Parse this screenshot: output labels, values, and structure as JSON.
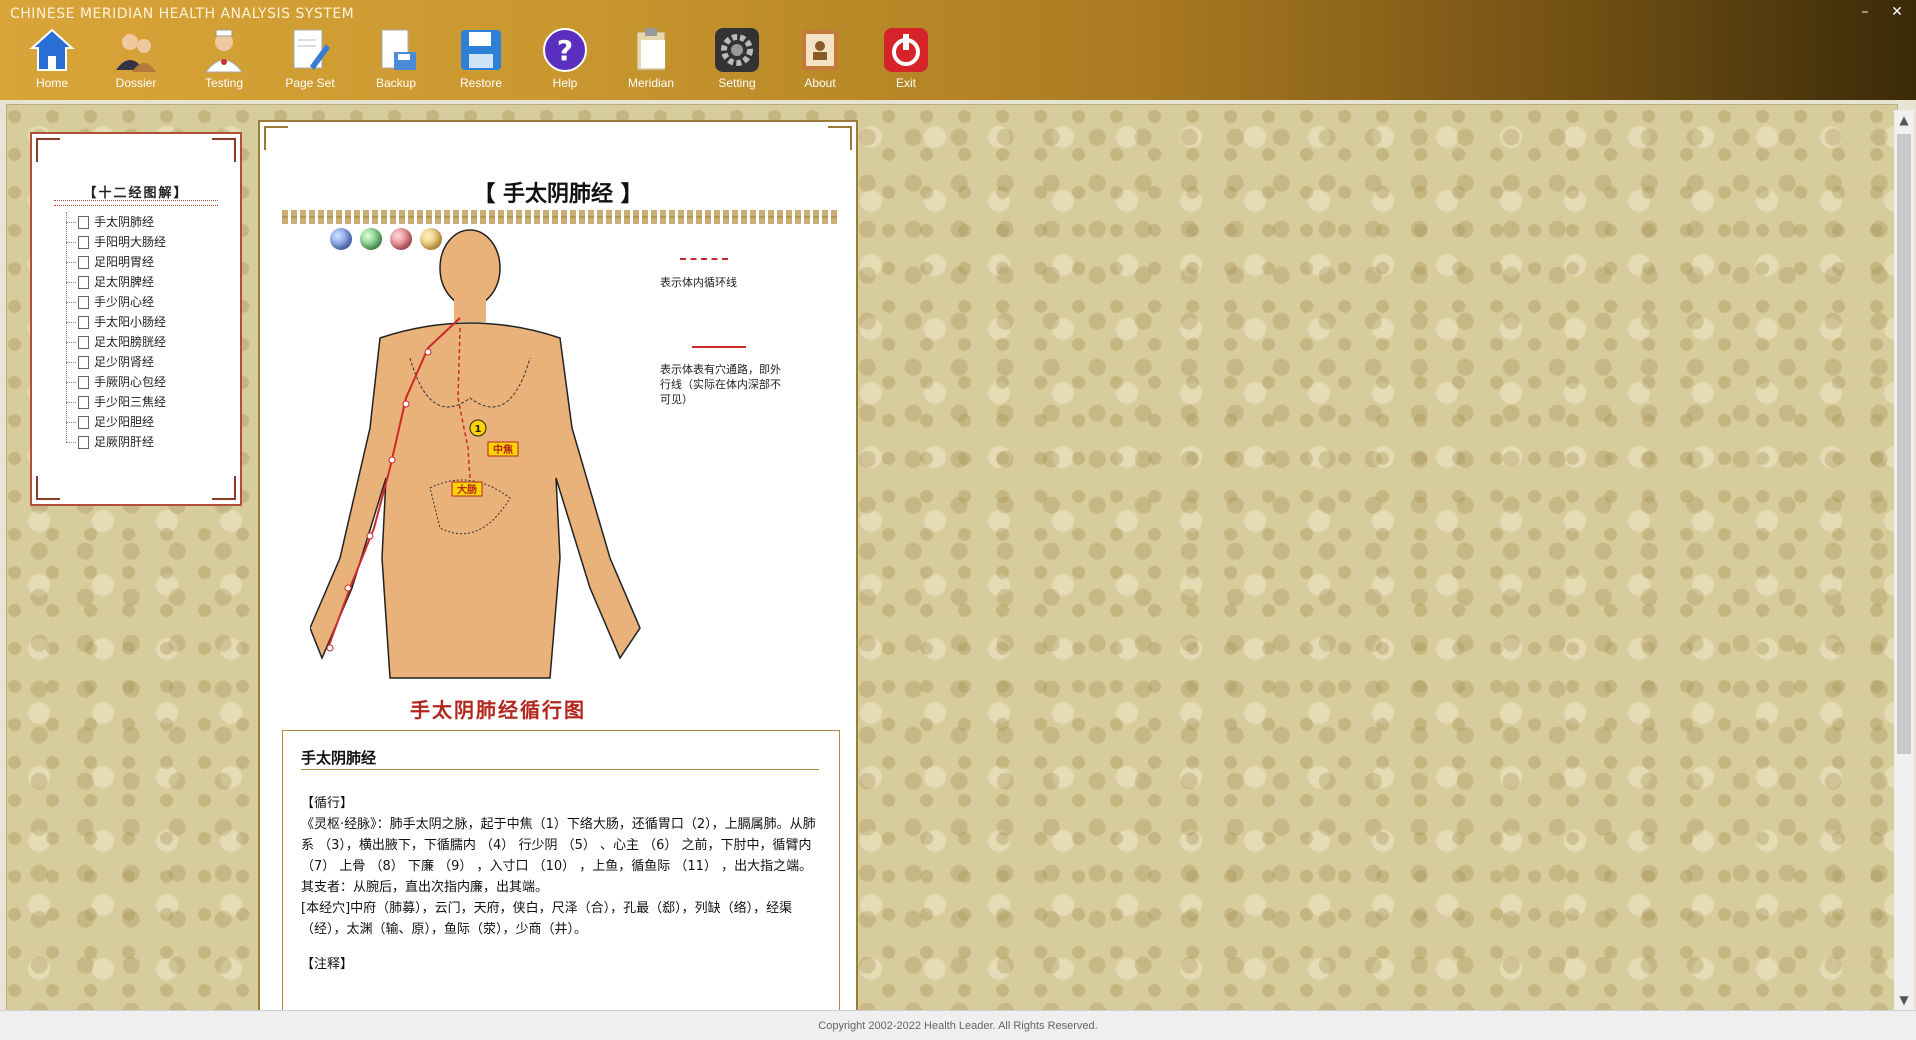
{
  "app": {
    "title": "CHINESE MERIDIAN HEALTH ANALYSIS SYSTEM"
  },
  "window_controls": {
    "minimize": "–",
    "close": "✕"
  },
  "toolbar": [
    {
      "label": "Home",
      "icon": "home-icon"
    },
    {
      "label": "Dossier",
      "icon": "users-icon"
    },
    {
      "label": "Testing",
      "icon": "doctor-icon"
    },
    {
      "label": "Page Set",
      "icon": "page-edit-icon"
    },
    {
      "label": "Backup",
      "icon": "backup-icon"
    },
    {
      "label": "Restore",
      "icon": "save-icon"
    },
    {
      "label": "Help",
      "icon": "help-icon"
    },
    {
      "label": "Meridian",
      "icon": "clipboard-icon"
    },
    {
      "label": "Setting",
      "icon": "gear-icon"
    },
    {
      "label": "About",
      "icon": "about-icon"
    },
    {
      "label": "Exit",
      "icon": "power-icon"
    }
  ],
  "left_panel": {
    "title": "【十二经图解】",
    "items": [
      "手太阴肺经",
      "手阳明大肠经",
      "足阳明胃经",
      "足太阴脾经",
      "手少阴心经",
      "手太阳小肠经",
      "足太阳膀胱经",
      "足少阴肾经",
      "手厥阴心包经",
      "手少阳三焦经",
      "足少阳胆经",
      "足厥阴肝经"
    ]
  },
  "content": {
    "heading": "【  手太阴肺经  】",
    "legend_dashed": "表示体内循环线",
    "legend_solid": "表示体表有穴通路，即外行线（实际在体内深部不可见）",
    "figure_labels": {
      "point": "1",
      "zhongjiao": "中焦",
      "dachang": "大肠"
    },
    "figure_caption": "手太阴肺经循行图",
    "text_title": "手太阴肺经",
    "section_1": "【循行】",
    "para_1": "《灵枢·经脉》：肺手太阴之脉，起于中焦（1）下络大肠，还循胃口（2），上膈属肺。从肺系 （3），横出腋下，下循臑内 （4） 行少阴 （5） 、心主 （6） 之前，下肘中，循臂内 （7） 上骨 （8） 下廉 （9） ，入寸口 （10） ，上鱼，循鱼际 （11） ，出大指之端。",
    "para_2": "其支者：从腕后，直出次指内廉，出其端。",
    "para_3": "[本经穴]中府（肺募），云门，天府，侠白，尺泽（合），孔最（郄），列缺（络），经渠（经），太渊（输、原），鱼际（荥），少商（井）。",
    "section_2": "【注释】"
  },
  "footer": {
    "copyright": "Copyright 2002-2022 Health Leader.  All Rights Reserved."
  },
  "colors": {
    "accent": "#c9972e",
    "meridian_red": "#cc2a2a",
    "frame_brown": "#9c7a3a"
  }
}
